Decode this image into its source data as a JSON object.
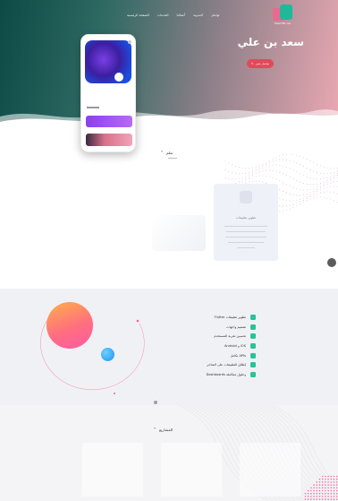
{
  "colors": {
    "hero_gradient_start": "#0d4a45",
    "hero_gradient_end": "#e9a8b2",
    "accent_red": "#e3495a",
    "accent_green": "#29c29a",
    "accent_purple": "#8a3ff0",
    "logo_pink": "#e86a8c",
    "logo_teal": "#1fb99a"
  },
  "nav": {
    "items": [
      "الصفحة الرئيسية",
      "الخدمات",
      "أعمالنا",
      "المدونة",
      "تواصل"
    ]
  },
  "logo": {
    "caption": "Saad Bin Ali"
  },
  "hero": {
    "title": "سعد بن علي",
    "button_label": "تواصل معي",
    "button_icon": "pencil-icon"
  },
  "about": {
    "heading": "تعلم",
    "card": {
      "icon": "app-icon",
      "title": "تطوير تطبيقات"
    }
  },
  "features": {
    "items": [
      "Flutter تطوير تطبيقات",
      "تصميم واجهات",
      "تحسين تجربة المستخدم",
      "Android و iOS",
      "تكامل APIs",
      "إطلاق التطبيقات على المتاجر",
      "Dashboards وحلول متكاملة"
    ]
  },
  "projects": {
    "heading": "المشاريع"
  }
}
